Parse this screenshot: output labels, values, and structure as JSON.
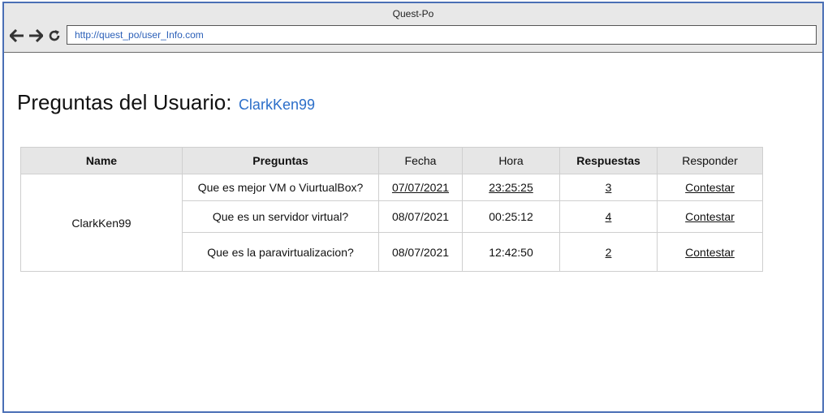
{
  "window": {
    "title": "Quest-Po",
    "url": "http://quest_po/user_Info.com"
  },
  "icons": {
    "back": "arrow-left-icon",
    "forward": "arrow-right-icon",
    "reload": "reload-icon"
  },
  "page": {
    "heading": "Preguntas del Usuario:",
    "username": "ClarkKen99"
  },
  "table": {
    "headers": {
      "name": "Name",
      "preguntas": "Preguntas",
      "fecha": "Fecha",
      "hora": "Hora",
      "respuestas": "Respuestas",
      "responder": "Responder"
    },
    "user": "ClarkKen99",
    "rows": [
      {
        "pregunta": "Que es mejor VM o ViurtualBox?",
        "fecha": "07/07/2021",
        "hora": "23:25:25",
        "respuestas": "3",
        "accion": "Contestar"
      },
      {
        "pregunta": "Que es un servidor virtual?",
        "fecha": "08/07/2021",
        "hora": "00:25:12",
        "respuestas": "4",
        "accion": "Contestar"
      },
      {
        "pregunta": "Que es la paravirtualizacion?",
        "fecha": "08/07/2021",
        "hora": "12:42:50",
        "respuestas": "2",
        "accion": "Contestar"
      }
    ]
  },
  "colors": {
    "frame_border": "#4a6fb5",
    "link_accent": "#2b6ec9",
    "header_bg": "#e6e6e6"
  }
}
